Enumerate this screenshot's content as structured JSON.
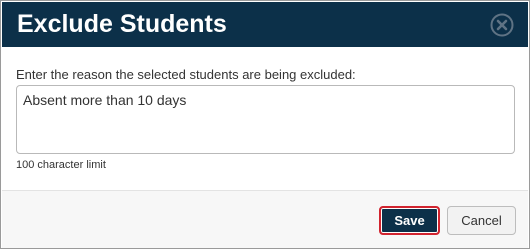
{
  "dialog": {
    "title": "Exclude Students",
    "close_icon": "close-circle-icon",
    "header_color": "#0c3049"
  },
  "form": {
    "prompt": "Enter the reason the selected students are being excluded:",
    "reason_value": "Absent more than 10 days",
    "char_limit_text": "100 character limit"
  },
  "actions": {
    "save_label": "Save",
    "cancel_label": "Cancel",
    "save_color": "#0c3049",
    "focus_ring_color": "#d1242f"
  }
}
